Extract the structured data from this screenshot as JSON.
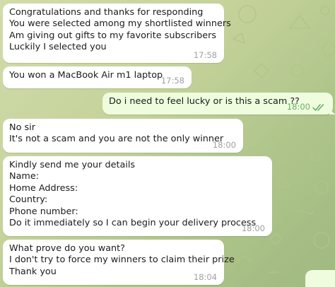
{
  "messages": [
    {
      "direction": "in",
      "lines": [
        "Congratulations and thanks for responding",
        "You were selected among my shortlisted winners",
        "Am giving out gifts to my favorite subscribers",
        "Luckily I selected you"
      ],
      "time": "17:58"
    },
    {
      "direction": "in",
      "lines": [
        "You won a MacBook Air m1 laptop"
      ],
      "time": "17:58"
    },
    {
      "direction": "out",
      "lines": [
        "Do i need to feel lucky or is this a scam ??"
      ],
      "time": "18:00",
      "read": true
    },
    {
      "direction": "in",
      "lines": [
        "No sir",
        "It's not a scam and you are not the only winner"
      ],
      "time": "18:00"
    },
    {
      "direction": "in",
      "lines": [
        "Kindly send me your details",
        "Name:",
        "Home Address:",
        "Country:",
        "Phone number:",
        "Do it immediately so I can begin your delivery process"
      ],
      "time": "18:00"
    },
    {
      "direction": "in",
      "lines": [
        "What prove do you want?",
        "I don't try to force my winners to claim their prize",
        "Thank you"
      ],
      "time": "18:04"
    }
  ],
  "colors": {
    "incoming_bubble": "#ffffff",
    "outgoing_bubble": "#effdde",
    "outgoing_meta": "#6aae6a",
    "incoming_meta": "#a0a0a0",
    "wallpaper": "#c4d29a"
  }
}
